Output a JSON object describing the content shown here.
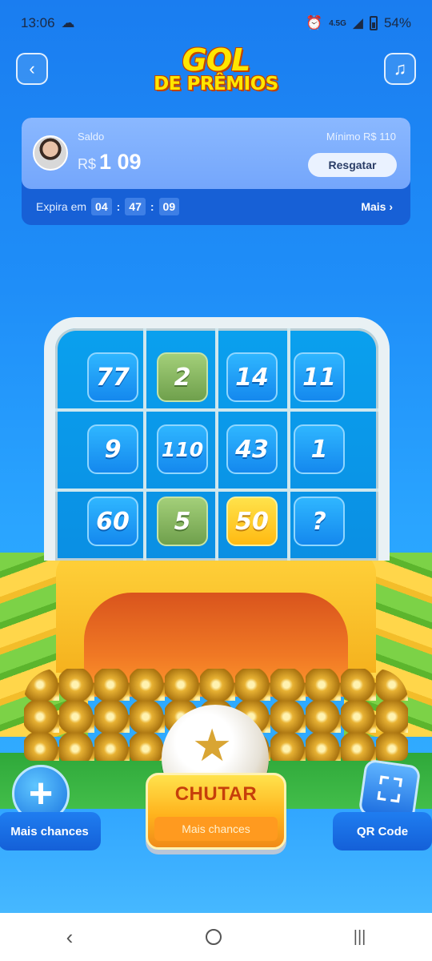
{
  "status_bar": {
    "time": "13:06",
    "network": "4.5G",
    "battery": "54%"
  },
  "header": {
    "title_line1": "GOL",
    "title_line2": "DE PRÊMIOS"
  },
  "balance_card": {
    "saldo_label": "Saldo",
    "currency": "R$",
    "amount": "1 09",
    "minimum_label": "Mínimo  R$ 110",
    "redeem_label": "Resgatar",
    "expires_label": "Expira em",
    "timer": {
      "hours": "04",
      "minutes": "47",
      "seconds": "09"
    },
    "more_label": "Mais"
  },
  "grid": {
    "cells": [
      {
        "value": "77",
        "color": "blue"
      },
      {
        "value": "2",
        "color": "green"
      },
      {
        "value": "14",
        "color": "blue"
      },
      {
        "value": "11",
        "color": "blue"
      },
      {
        "value": "9",
        "color": "blue"
      },
      {
        "value": "110",
        "color": "blue"
      },
      {
        "value": "43",
        "color": "blue"
      },
      {
        "value": "1",
        "color": "blue"
      },
      {
        "value": "60",
        "color": "blue"
      },
      {
        "value": "5",
        "color": "green"
      },
      {
        "value": "50",
        "color": "gold"
      },
      {
        "value": "?",
        "color": "blue"
      }
    ]
  },
  "actions": {
    "more_chances_label": "Mais chances",
    "kick_label": "CHUTAR",
    "kick_sub_label": "Mais chances",
    "qr_label": "QR Code"
  },
  "icons": {
    "back": "chevron-left-icon",
    "music": "music-note-icon",
    "plus": "plus-icon",
    "qr": "qr-scan-icon",
    "more": "chevron-right-icon"
  }
}
